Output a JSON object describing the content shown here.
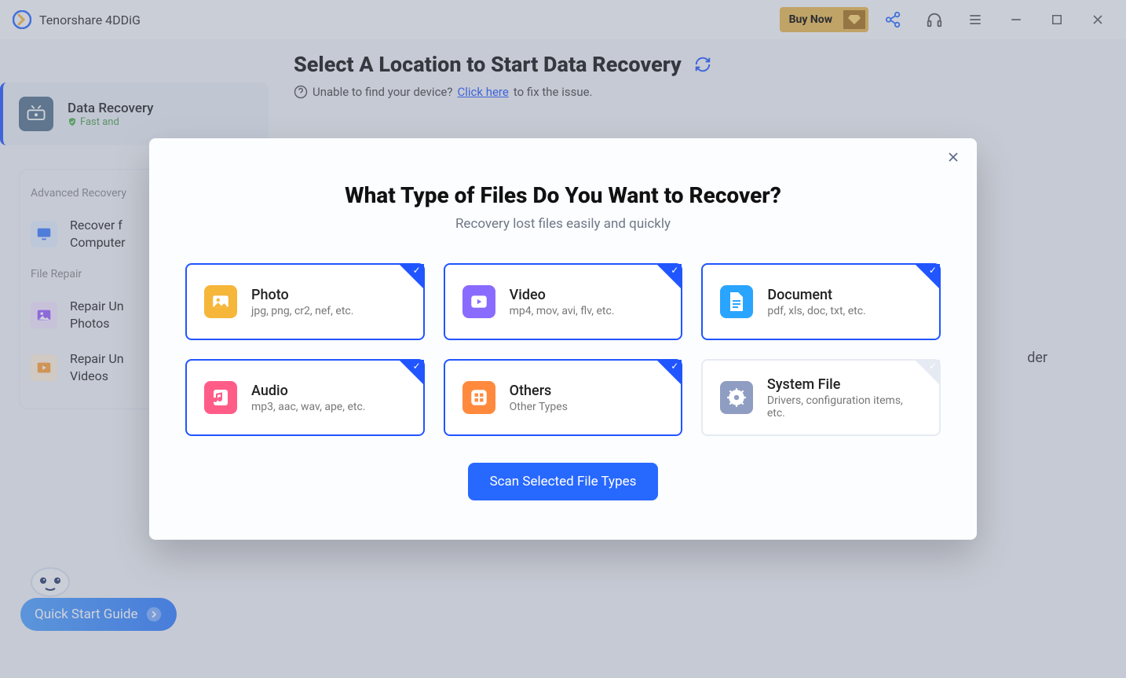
{
  "app": {
    "title": "Tenorshare 4DDiG",
    "buy_now": "Buy Now"
  },
  "sidebar": {
    "active": {
      "title": "Data Recovery",
      "sub": "Fast and"
    },
    "group1": {
      "heading": "Advanced Recovery",
      "item": "Recover f\nComputer"
    },
    "group2": {
      "heading": "File Repair",
      "item1": "Repair Un\nPhotos",
      "item2": "Repair Un\nVideos"
    },
    "qsg": "Quick Start Guide"
  },
  "page": {
    "title": "Select A Location to Start Data Recovery",
    "help_pre": "Unable to find your device?",
    "help_link": "Click here",
    "help_post": "to fix the issue.",
    "folder_hint": "der"
  },
  "modal": {
    "title": "What Type of Files Do You Want to Recover?",
    "subtitle": "Recovery lost files easily and quickly",
    "cards": [
      {
        "title": "Photo",
        "desc": "jpg, png, cr2, nef, etc.",
        "color": "#f5b63a",
        "selected": true
      },
      {
        "title": "Video",
        "desc": "mp4, mov, avi, flv, etc.",
        "color": "#8a6bff",
        "selected": true
      },
      {
        "title": "Document",
        "desc": "pdf, xls, doc, txt, etc.",
        "color": "#2aa5ff",
        "selected": true
      },
      {
        "title": "Audio",
        "desc": "mp3, aac, wav, ape, etc.",
        "color": "#ff5d88",
        "selected": true
      },
      {
        "title": "Others",
        "desc": "Other Types",
        "color": "#ff8a3d",
        "selected": true
      },
      {
        "title": "System File",
        "desc": "Drivers, configuration items, etc.",
        "color": "#8f9dc2",
        "selected": false
      }
    ],
    "scan": "Scan Selected File Types"
  }
}
